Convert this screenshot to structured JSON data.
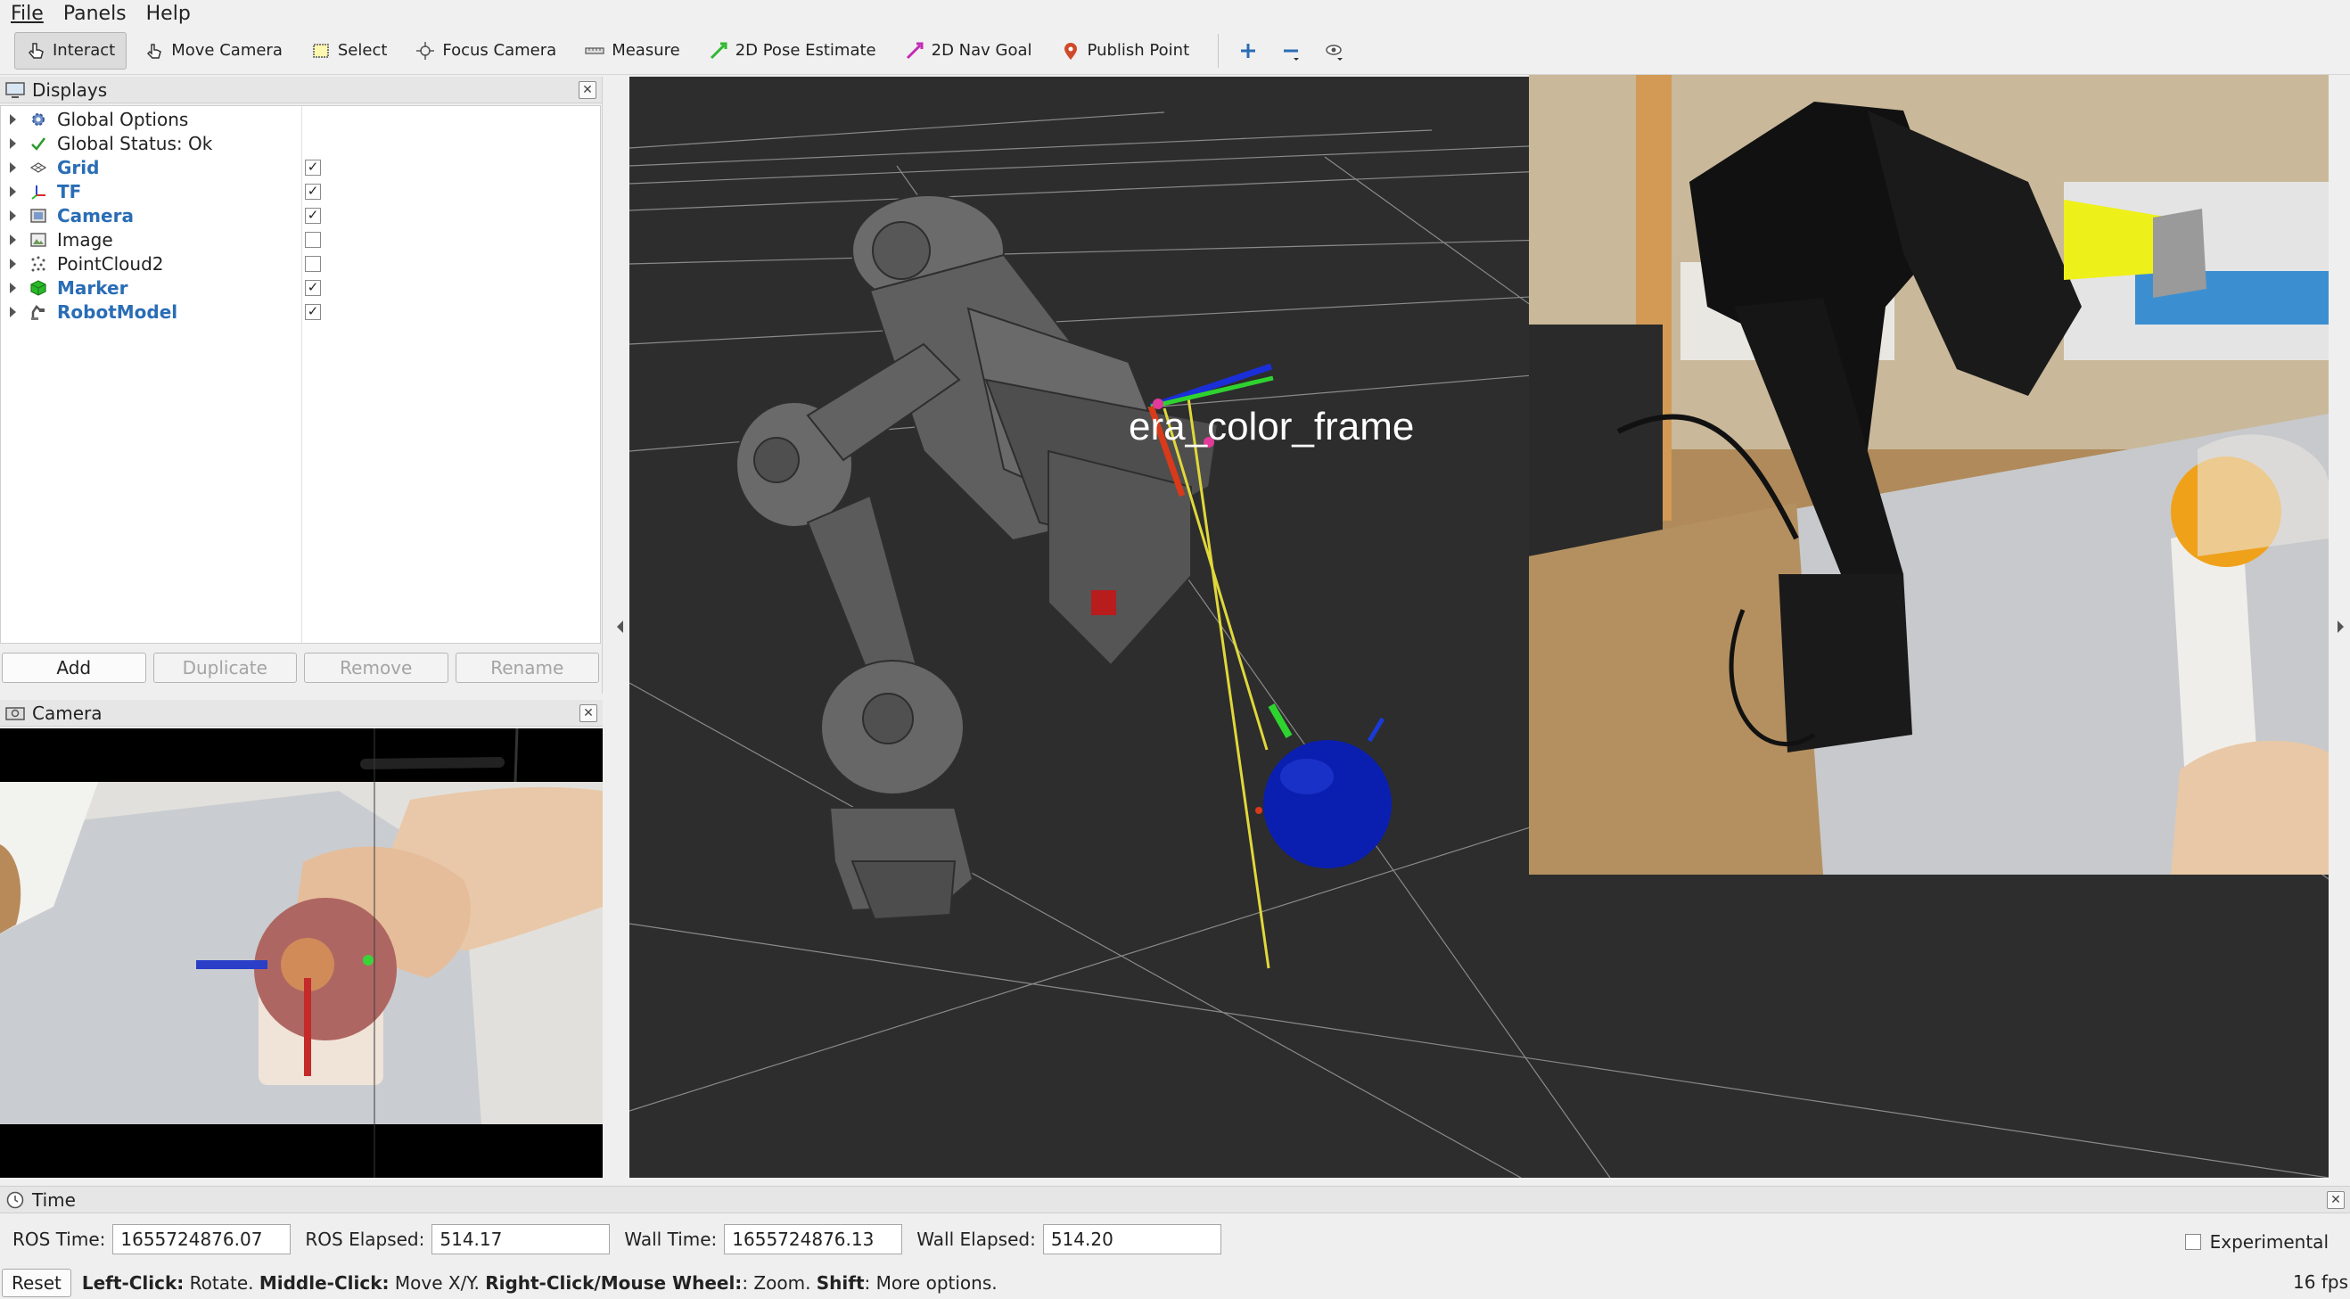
{
  "menu": {
    "file": "File",
    "panels": "Panels",
    "help": "Help"
  },
  "toolbar": {
    "interact": "Interact",
    "move_camera": "Move Camera",
    "select": "Select",
    "focus_camera": "Focus Camera",
    "measure": "Measure",
    "pose_estimate": "2D Pose Estimate",
    "nav_goal": "2D Nav Goal",
    "publish_point": "Publish Point"
  },
  "displays": {
    "title": "Displays",
    "items": [
      {
        "label": "Global Options",
        "icon": "gear-icon",
        "checkbox": null,
        "highlight": false
      },
      {
        "label": "Global Status: Ok",
        "icon": "check-icon",
        "checkbox": null,
        "highlight": false
      },
      {
        "label": "Grid",
        "icon": "grid-icon",
        "checkbox": true,
        "highlight": true
      },
      {
        "label": "TF",
        "icon": "axes-icon",
        "checkbox": true,
        "highlight": true
      },
      {
        "label": "Camera",
        "icon": "camera-icon",
        "checkbox": true,
        "highlight": true
      },
      {
        "label": "Image",
        "icon": "image-icon",
        "checkbox": false,
        "highlight": false
      },
      {
        "label": "PointCloud2",
        "icon": "pointcloud-icon",
        "checkbox": false,
        "highlight": false
      },
      {
        "label": "Marker",
        "icon": "cube-icon",
        "checkbox": true,
        "highlight": true
      },
      {
        "label": "RobotModel",
        "icon": "robot-icon",
        "checkbox": true,
        "highlight": true
      }
    ],
    "buttons": {
      "add": "Add",
      "duplicate": "Duplicate",
      "remove": "Remove",
      "rename": "Rename"
    }
  },
  "camera_panel": {
    "title": "Camera"
  },
  "render": {
    "frame_label": "era_color_frame"
  },
  "time": {
    "title": "Time",
    "ros_time_label": "ROS Time:",
    "ros_time": "1655724876.07",
    "ros_elapsed_label": "ROS Elapsed:",
    "ros_elapsed": "514.17",
    "wall_time_label": "Wall Time:",
    "wall_time": "1655724876.13",
    "wall_elapsed_label": "Wall Elapsed:",
    "wall_elapsed": "514.20",
    "experimental": "Experimental"
  },
  "status": {
    "reset": "Reset",
    "left_click": "Left-Click:",
    "left_click_desc": " Rotate. ",
    "middle_click": "Middle-Click:",
    "middle_click_desc": " Move X/Y. ",
    "right_click": "Right-Click/Mouse Wheel:",
    "right_click_desc": ": Zoom. ",
    "shift": "Shift",
    "shift_desc": ": More options.",
    "fps": "16 fps"
  },
  "colors": {
    "accent_blue": "#2a6db5",
    "viewport_bg": "#2d2d2d",
    "marker_sphere": "#0a1fb0"
  }
}
